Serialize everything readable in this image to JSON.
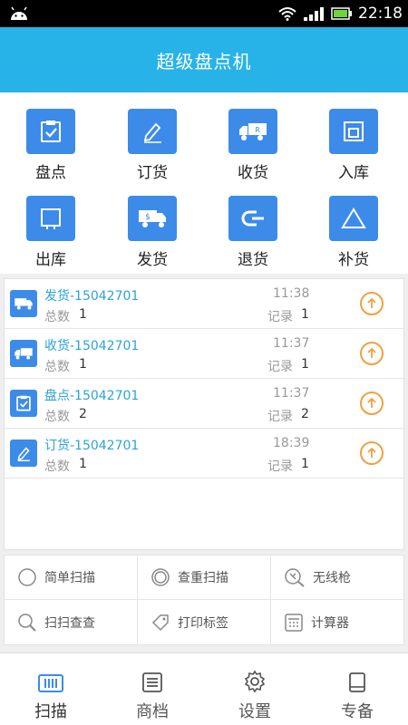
{
  "status_bar": {
    "time": "22:18"
  },
  "header": {
    "title": "超级盘点机"
  },
  "grid": [
    {
      "label": "盘点",
      "icon": "clipboard-check-icon"
    },
    {
      "label": "订货",
      "icon": "pen-icon"
    },
    {
      "label": "收货",
      "icon": "truck-icon"
    },
    {
      "label": "入库",
      "icon": "box-in-icon"
    },
    {
      "label": "出库",
      "icon": "box-out-icon"
    },
    {
      "label": "发货",
      "icon": "delivery-truck-icon"
    },
    {
      "label": "退货",
      "icon": "return-icon"
    },
    {
      "label": "补货",
      "icon": "triangle-icon"
    }
  ],
  "records": [
    {
      "name": "发货-15042701",
      "total_label": "总数",
      "total": "1",
      "time": "11:38",
      "record_label": "记录",
      "record": "1",
      "icon": "delivery-truck-icon"
    },
    {
      "name": "收货-15042701",
      "total_label": "总数",
      "total": "1",
      "time": "11:37",
      "record_label": "记录",
      "record": "1",
      "icon": "truck-icon"
    },
    {
      "name": "盘点-15042701",
      "total_label": "总数",
      "total": "2",
      "time": "11:37",
      "record_label": "记录",
      "record": "2",
      "icon": "clipboard-check-icon"
    },
    {
      "name": "订货-15042701",
      "total_label": "总数",
      "total": "1",
      "time": "18:39",
      "record_label": "记录",
      "record": "1",
      "icon": "pen-icon"
    }
  ],
  "tools": [
    {
      "label": "简单扫描",
      "icon": "circle-icon"
    },
    {
      "label": "查重扫描",
      "icon": "double-circle-icon"
    },
    {
      "label": "无线枪",
      "icon": "scanner-icon"
    },
    {
      "label": "扫扫查查",
      "icon": "search-icon"
    },
    {
      "label": "打印标签",
      "icon": "tag-icon"
    },
    {
      "label": "计算器",
      "icon": "calculator-icon"
    }
  ],
  "nav": [
    {
      "label": "扫描",
      "icon": "barcode-icon",
      "active": true
    },
    {
      "label": "商档",
      "icon": "list-icon",
      "active": false
    },
    {
      "label": "设置",
      "icon": "gear-icon",
      "active": false
    },
    {
      "label": "专备",
      "icon": "book-icon",
      "active": false
    }
  ],
  "colors": {
    "header": "#27b3e8",
    "tile": "#3d8be8",
    "record_name": "#2aa3d8",
    "upload": "#f0a040",
    "nav_active": "#3d8be8"
  }
}
